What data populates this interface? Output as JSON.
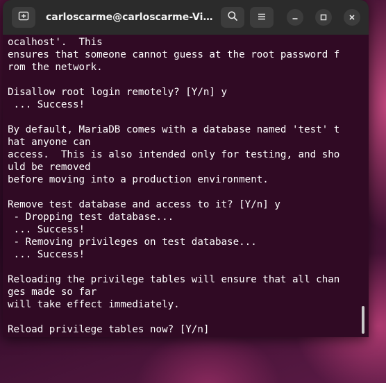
{
  "window": {
    "title": "carloscarme@carloscarme-Vir..."
  },
  "titlebar": {
    "new_tab_icon": "new-tab-icon",
    "search_icon": "search-icon",
    "menu_icon": "hamburger-menu-icon",
    "minimize_icon": "minimize-icon",
    "maximize_icon": "maximize-icon",
    "close_icon": "close-icon"
  },
  "terminal": {
    "lines": [
      "ocalhost'.  This",
      "ensures that someone cannot guess at the root password f",
      "rom the network.",
      "",
      "Disallow root login remotely? [Y/n] y",
      " ... Success!",
      "",
      "By default, MariaDB comes with a database named 'test' t",
      "hat anyone can",
      "access.  This is also intended only for testing, and sho",
      "uld be removed",
      "before moving into a production environment.",
      "",
      "Remove test database and access to it? [Y/n] y",
      " - Dropping test database...",
      " ... Success!",
      " - Removing privileges on test database...",
      " ... Success!",
      "",
      "Reloading the privilege tables will ensure that all chan",
      "ges made so far",
      "will take effect immediately.",
      "",
      "Reload privilege tables now? [Y/n]"
    ]
  },
  "colors": {
    "terminal_bg": "#300a24",
    "titlebar_bg": "#2b2b2b",
    "text": "#ffffff"
  }
}
